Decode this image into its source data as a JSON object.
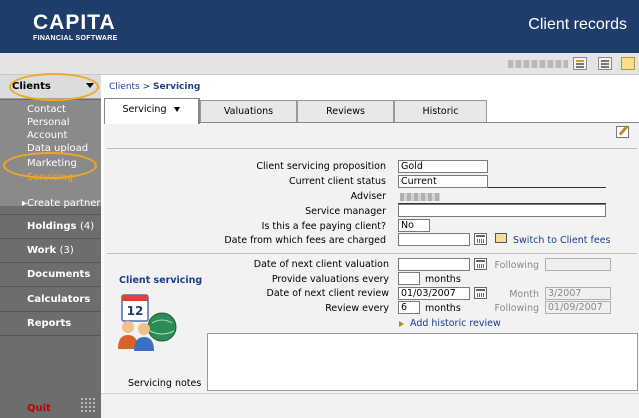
{
  "header": {
    "logo_main": "CAPITA",
    "logo_sub": "FINANCIAL SOFTWARE",
    "title": "Client records"
  },
  "toolbar": {
    "icons": [
      "notes-icon",
      "list-icon",
      "folder-icon"
    ]
  },
  "sidebar": {
    "clients_label": "Clients",
    "sub_items": [
      "Contact",
      "Personal",
      "Account",
      "Data upload",
      "Marketing",
      "Servicing"
    ],
    "active_sub_item": "Servicing",
    "create_partner": "Create partner",
    "holdings": "Holdings",
    "holdings_count": "(4)",
    "work": "Work",
    "work_count": "(3)",
    "documents": "Documents",
    "calculators": "Calculators",
    "reports": "Reports",
    "quit": "Quit"
  },
  "breadcrumb": {
    "parent": "Clients",
    "separator": ">",
    "current": "Servicing"
  },
  "tabs": [
    {
      "label": "Servicing",
      "active": true
    },
    {
      "label": "Valuations",
      "active": false
    },
    {
      "label": "Reviews",
      "active": false
    },
    {
      "label": "Historic",
      "active": false
    }
  ],
  "form": {
    "proposition_label": "Client servicing proposition",
    "proposition_value": "Gold",
    "status_label": "Current client status",
    "status_value": "Current",
    "adviser_label": "Adviser",
    "manager_label": "Service manager",
    "fee_label": "Is this a fee paying client?",
    "fee_value": "No",
    "fees_date_label": "Date from which fees are charged",
    "fees_date_value": "",
    "switch_link": "Switch to Client fees",
    "next_valuation_label": "Date of next client valuation",
    "next_valuation_value": "",
    "following_label": "Following",
    "following_valuation_value": "",
    "valuations_every_label": "Provide valuations every",
    "valuations_every_value": "",
    "months_label": "months",
    "next_review_label": "Date of next client review",
    "next_review_value": "01/03/2007",
    "month_label": "Month",
    "month_value": "3/2007",
    "review_every_label": "Review every",
    "review_every_value": "6",
    "following_review_value": "01/09/2007",
    "add_historic_link": "Add historic review",
    "client_servicing_title": "Client servicing",
    "notes_label": "Servicing notes",
    "notes_value": ""
  },
  "colors": {
    "header_bg": "#1f3d6b",
    "sidebar_bg": "#6d6d6d",
    "accent_orange": "#f5a623",
    "link_blue": "#1a3d8f",
    "quit_red": "#c00000"
  }
}
